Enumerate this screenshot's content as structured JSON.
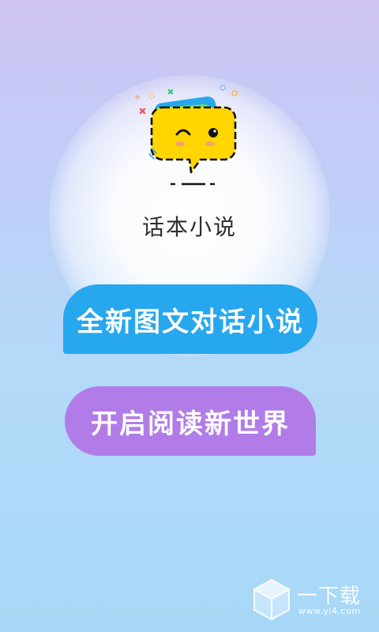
{
  "app": {
    "name": "话本小说",
    "slogans": [
      "全新图文对话小说",
      "开启阅读新世界"
    ]
  },
  "watermark": {
    "brand": "一下载",
    "url": "www.yi4.com"
  },
  "colors": {
    "blue_bubble": "#27a7ee",
    "purple_bubble": "#b17ce8",
    "logo_yellow": "#ffd600"
  }
}
